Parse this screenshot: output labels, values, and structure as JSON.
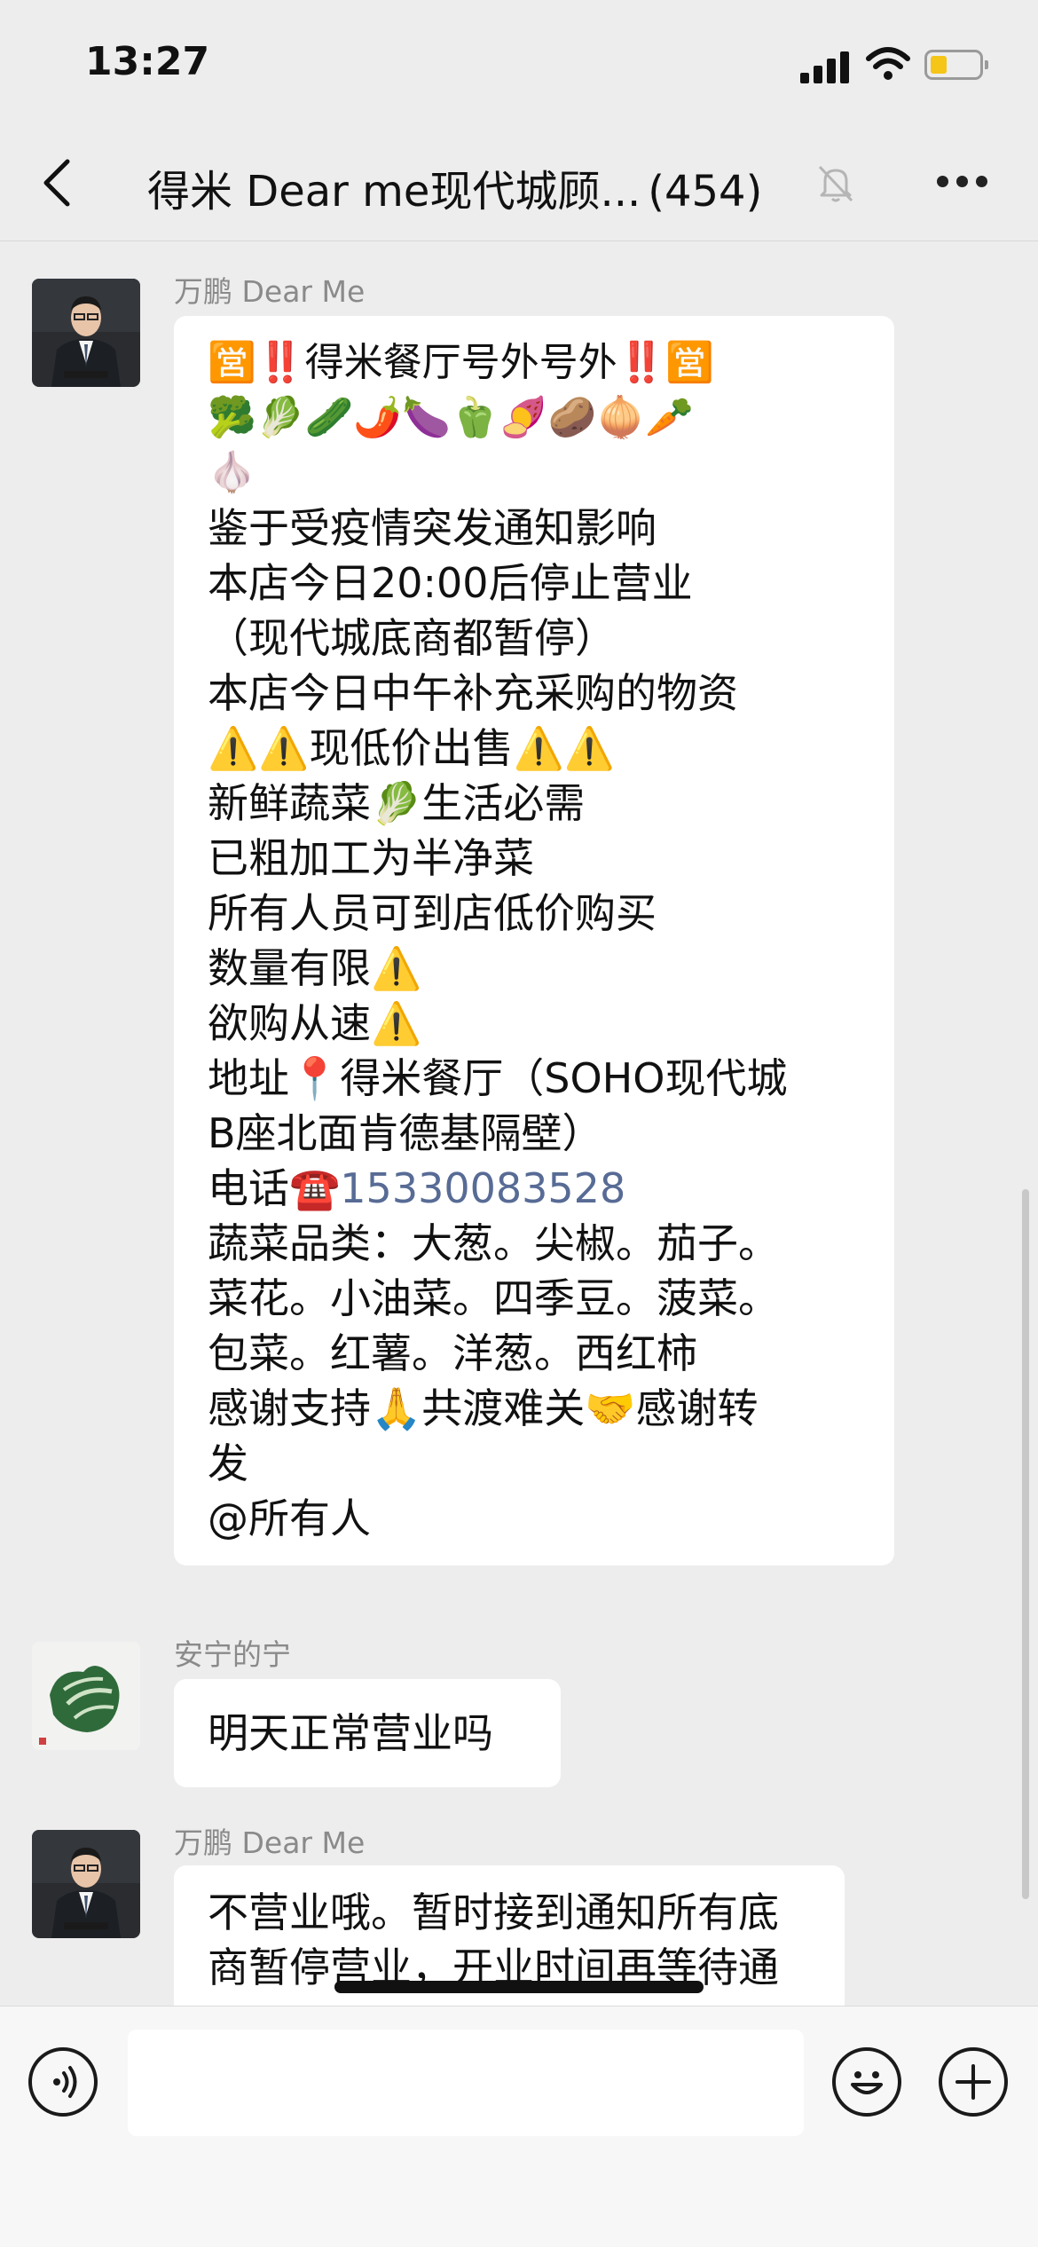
{
  "status": {
    "time": "13:27"
  },
  "header": {
    "title": "得米 Dear   me现代城顾...",
    "count": "(454)"
  },
  "messages": [
    {
      "sender": "万鹏 Dear Me",
      "lines": [
        "🈺‼️得米餐厅号外号外‼️🈺",
        "🥦🥬🥒🌶️🍆🫑🍠🥔🧅🥕",
        "🧄",
        "鉴于受疫情突发通知影响",
        "本店今日20:00后停止营业",
        "（现代城底商都暂停）",
        "本店今日中午补充采购的物资",
        "⚠️⚠️现低价出售⚠️⚠️",
        "新鲜蔬菜🥬生活必需",
        "已粗加工为半净菜",
        "所有人员可到店低价购买",
        "数量有限⚠️",
        "欲购从速⚠️",
        "地址📍得米餐厅（SOHO现代城",
        "B座北面肯德基隔壁）",
        "电话☎️",
        "蔬菜品类：大葱。尖椒。茄子。",
        "菜花。小油菜。四季豆。菠菜。",
        "包菜。红薯。洋葱。西红柿",
        "感谢支持🙏共渡难关🤝感谢转",
        "发",
        "@所有人"
      ],
      "phone": "15330083528"
    },
    {
      "sender": "安宁的宁",
      "lines": [
        "明天正常营业吗"
      ]
    },
    {
      "sender": "万鹏 Dear Me",
      "lines": [
        "不营业哦。暂时接到通知所有底",
        "商暂停营业，开业时间再等待通"
      ]
    }
  ],
  "icons": {
    "back": "chevron-left-icon",
    "mute": "bell-slash-icon",
    "more": "more-icon",
    "voice": "voice-icon",
    "emoji": "emoji-icon",
    "plus": "plus-icon"
  }
}
